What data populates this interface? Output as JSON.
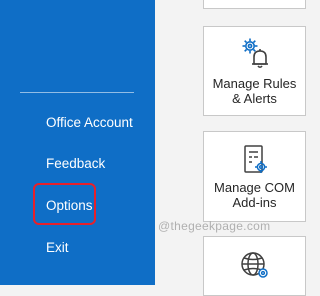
{
  "nav": {
    "items": [
      {
        "label": "Office Account"
      },
      {
        "label": "Feedback"
      },
      {
        "label": "Options"
      },
      {
        "label": "Exit"
      }
    ]
  },
  "tiles": {
    "rules": {
      "line1": "Manage Rules",
      "line2": "& Alerts",
      "icon": "rules-alerts-icon"
    },
    "com": {
      "line1": "Manage COM",
      "line2": "Add-ins",
      "icon": "com-addins-icon"
    },
    "bottom": {
      "icon": "globe-settings-icon"
    }
  },
  "watermark": {
    "text": "@thegeekpage.com"
  },
  "colors": {
    "nav_background": "#0f6ec6",
    "highlight": "#e8202a",
    "content_background": "#f3f3f3",
    "icon_stroke": "#404040",
    "icon_accent": "#0f6ec6"
  }
}
